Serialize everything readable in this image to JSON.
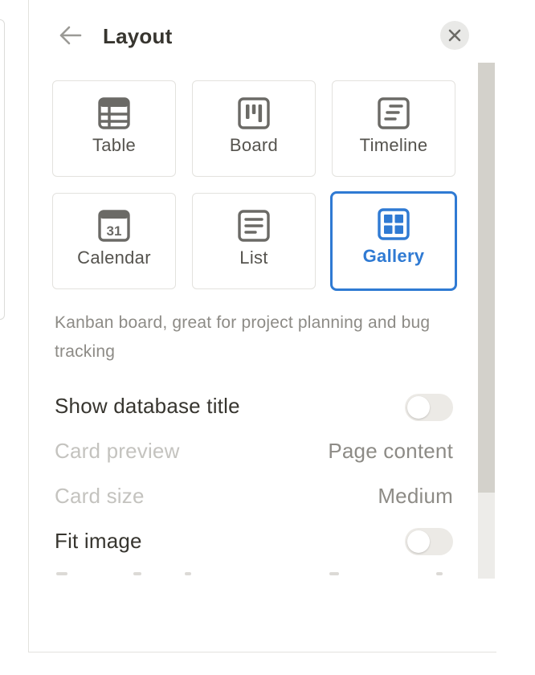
{
  "header": {
    "title": "Layout",
    "back_icon": "arrow-left-icon",
    "close_icon": "close-icon"
  },
  "layouts": [
    {
      "label": "Table",
      "icon": "table-icon",
      "selected": false
    },
    {
      "label": "Board",
      "icon": "board-icon",
      "selected": false
    },
    {
      "label": "Timeline",
      "icon": "timeline-icon",
      "selected": false
    },
    {
      "label": "Calendar",
      "icon": "calendar-icon",
      "selected": false,
      "icon_text": "31"
    },
    {
      "label": "List",
      "icon": "list-icon",
      "selected": false
    },
    {
      "label": "Gallery",
      "icon": "gallery-icon",
      "selected": true
    }
  ],
  "description": "Kanban board, great for project planning and bug tracking",
  "settings": {
    "show_title": {
      "label": "Show database title",
      "enabled": true,
      "toggle_on": false
    },
    "card_preview": {
      "label": "Card preview",
      "value": "Page content",
      "enabled": false
    },
    "card_size": {
      "label": "Card size",
      "value": "Medium",
      "enabled": false
    },
    "fit_image": {
      "label": "Fit image",
      "enabled": true,
      "toggle_on": false
    }
  },
  "colors": {
    "accent": "#2f7ad3",
    "text": "#37352f",
    "muted": "#8d8b86",
    "disabled": "#c4c3bf",
    "icon": "#6b6a66"
  }
}
